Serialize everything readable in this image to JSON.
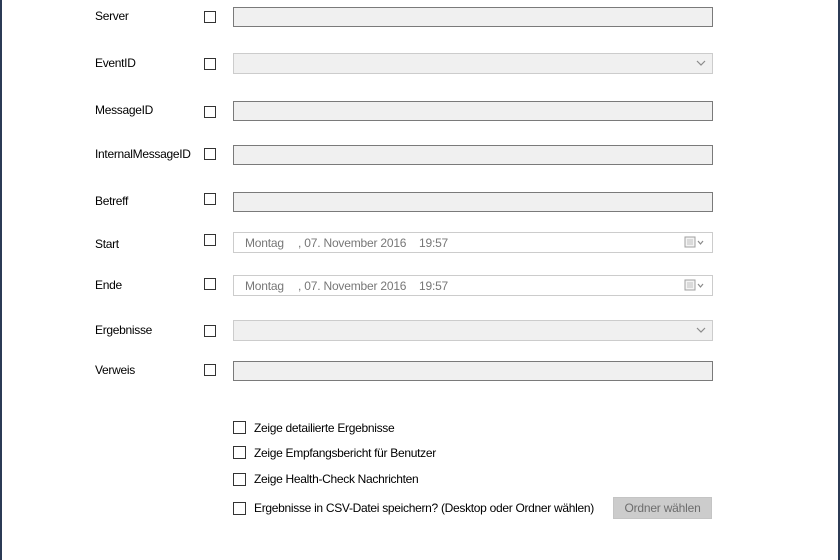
{
  "form": {
    "rows": [
      {
        "label": "Server"
      },
      {
        "label": "EventID"
      },
      {
        "label": "MessageID"
      },
      {
        "label": "InternalMessageID"
      },
      {
        "label": "Betreff"
      },
      {
        "label": "Start"
      },
      {
        "label": "Ende"
      },
      {
        "label": "Ergebnisse"
      },
      {
        "label": "Verweis"
      }
    ],
    "start": {
      "weekday": "Montag",
      "date": ", 07. November 2016",
      "time": "19:57"
    },
    "end": {
      "weekday": "Montag",
      "date": ", 07. November 2016",
      "time": "19:57"
    }
  },
  "options": [
    {
      "label": "Zeige detailierte Ergebnisse"
    },
    {
      "label": "Zeige Empfangsbericht für Benutzer"
    },
    {
      "label": "Zeige Health-Check Nachrichten"
    },
    {
      "label": "Ergebnisse in CSV-Datei speichern? (Desktop oder Ordner wählen)"
    }
  ],
  "folder_button": {
    "label": "Ordner wählen"
  },
  "colors": {
    "field_bg": "#f0f0f0",
    "button_bg": "#cccccc",
    "window_edge": "#2b3a55"
  }
}
